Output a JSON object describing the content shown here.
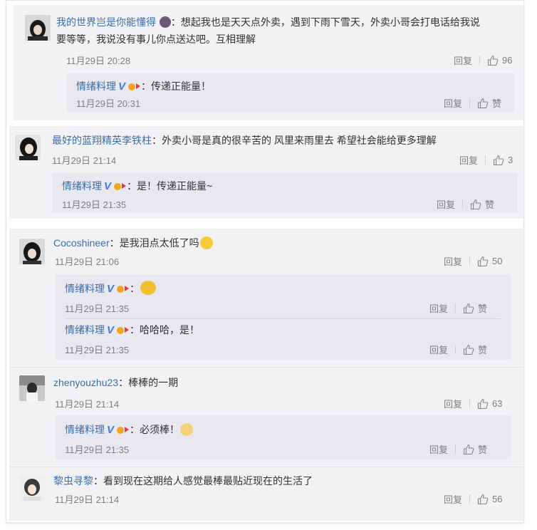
{
  "comments": [
    {
      "user": "我的世界岂是你能懂得",
      "colon": "：",
      "text_line1": "想起我也是天天点外卖，遇到下雨下雪天，外卖小哥会打电话给我说",
      "text_line2": "要等等，我说没有事儿你点送达吧。互相理解",
      "time": "11月29日 20:28",
      "reply_label": "回复",
      "likes": "96",
      "replies": [
        {
          "user": "情绪料理",
          "text": "传递正能量！",
          "time": "11月29日 20:31",
          "reply_label": "回复",
          "likes": "赞"
        }
      ]
    },
    {
      "user": "最好的蓝翔精英李铁柱",
      "colon": "：",
      "text": "外卖小哥是真的很辛苦的 风里来雨里去 希望社会能给更多理解",
      "time": "11月29日 21:14",
      "reply_label": "回复",
      "likes": "3",
      "replies": [
        {
          "user": "情绪料理",
          "text": "是！传递正能量~",
          "time": "11月29日 21:35",
          "reply_label": "回复",
          "likes": "赞"
        }
      ]
    },
    {
      "user": "Cocoshineer",
      "colon": "：",
      "text": "是我泪点太低了吗",
      "time": "11月29日 21:06",
      "reply_label": "回复",
      "likes": "50",
      "replies": [
        {
          "user": "情绪料理",
          "text": "",
          "time": "11月29日 21:35",
          "reply_label": "回复",
          "likes": "赞"
        },
        {
          "user": "情绪料理",
          "text": "哈哈哈，是！",
          "time": "11月29日 21:35",
          "reply_label": "回复",
          "likes": "赞"
        }
      ]
    },
    {
      "user": "zhenyouzhu23",
      "colon": "：",
      "text": "棒棒的一期",
      "time": "11月29日 21:14",
      "reply_label": "回复",
      "likes": "63",
      "replies": [
        {
          "user": "情绪料理",
          "text": "必须棒！",
          "time": "11月29日 21:35",
          "reply_label": "回复",
          "likes": "赞"
        }
      ]
    },
    {
      "user": "黎虫寻黎",
      "colon": "：",
      "text": "看到现在这期给人感觉最棒最贴近现在的生活了",
      "time": "11月29日 21:14",
      "reply_label": "回复",
      "likes": "56"
    }
  ],
  "reply_colon": "：",
  "verified_mark": "V",
  "icons": {
    "like": "thumbs-up-icon",
    "verified": "verified-v-icon",
    "badge": "member-badge-icon",
    "emoji": "emoji-icon"
  },
  "colors": {
    "name": "#3d6da8",
    "verified": "#3e7be6",
    "card": "#f2f2f5",
    "reply_box": "#e8e8ee"
  }
}
